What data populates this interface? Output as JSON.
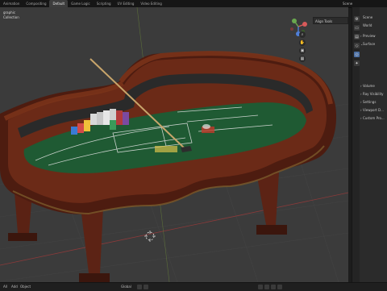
{
  "topbar": {
    "tabs": [
      "Animation",
      "Compositing",
      "Default",
      "Game Logic",
      "Scripting",
      "UV Editing",
      "Video Editing"
    ],
    "active_tab": "Default",
    "scene_label": "Scene"
  },
  "viewport": {
    "mode_label": "graphic",
    "collection_label": "Collection",
    "align_tools_label": "Align Tools"
  },
  "toolstrip": {
    "icons": [
      "tool-icon",
      "tool-icon",
      "tool-icon",
      "tool-icon",
      "tool-icon",
      "tool-icon"
    ]
  },
  "properties": {
    "scene_label": "Scene",
    "world_label": "World",
    "preview_label": "Preview",
    "surface_label": "Surface",
    "volume_label": "Volume",
    "ray_visibility_label": "Ray Visibility",
    "settings_label": "Settings",
    "viewport_display_label": "Viewport D...",
    "custom_properties_label": "Custom Pro..."
  },
  "statusbar": {
    "all_label": "All",
    "add_label": "Add",
    "object_label": "Object",
    "global_label": "Global"
  },
  "colors": {
    "felt": "#1f5a33",
    "wood": "#6b2f1d",
    "rail": "#5a2414",
    "viewport_bg": "#3b3b3b"
  }
}
